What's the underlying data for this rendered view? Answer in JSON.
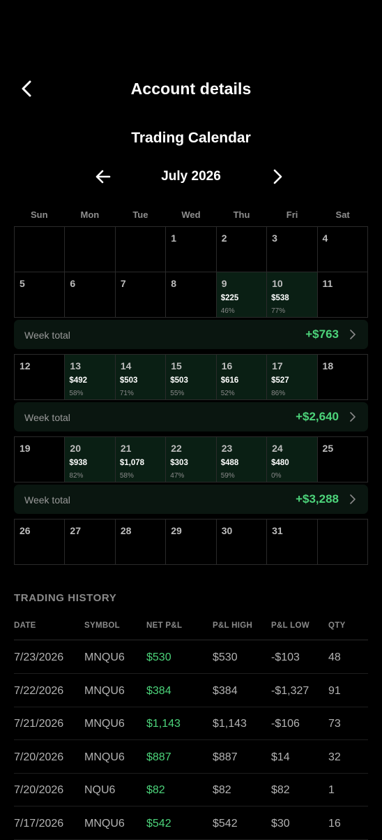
{
  "header": {
    "title": "Account details",
    "back_icon": "chevron-left-icon"
  },
  "calendar": {
    "title": "Trading Calendar",
    "month_label": "July 2026",
    "weekdays": [
      "Sun",
      "Mon",
      "Tue",
      "Wed",
      "Thu",
      "Fri",
      "Sat"
    ],
    "accent_color": "#4cd37a",
    "week_total_label": "Week total",
    "weeks": [
      {
        "days": [
          {
            "num": ""
          },
          {
            "num": ""
          },
          {
            "num": ""
          },
          {
            "num": "1"
          },
          {
            "num": "2"
          },
          {
            "num": "3"
          },
          {
            "num": "4"
          }
        ],
        "total": null
      },
      {
        "days": [
          {
            "num": "5"
          },
          {
            "num": "6"
          },
          {
            "num": "7"
          },
          {
            "num": "8"
          },
          {
            "num": "9",
            "amount": "$225",
            "pct": "46%"
          },
          {
            "num": "10",
            "amount": "$538",
            "pct": "77%"
          },
          {
            "num": "11"
          }
        ],
        "total": "+$763"
      },
      {
        "days": [
          {
            "num": "12"
          },
          {
            "num": "13",
            "amount": "$492",
            "pct": "58%"
          },
          {
            "num": "14",
            "amount": "$503",
            "pct": "71%"
          },
          {
            "num": "15",
            "amount": "$503",
            "pct": "55%"
          },
          {
            "num": "16",
            "amount": "$616",
            "pct": "52%"
          },
          {
            "num": "17",
            "amount": "$527",
            "pct": "86%"
          },
          {
            "num": "18"
          }
        ],
        "total": "+$2,640"
      },
      {
        "days": [
          {
            "num": "19"
          },
          {
            "num": "20",
            "amount": "$938",
            "pct": "82%"
          },
          {
            "num": "21",
            "amount": "$1,078",
            "pct": "58%"
          },
          {
            "num": "22",
            "amount": "$303",
            "pct": "47%"
          },
          {
            "num": "23",
            "amount": "$488",
            "pct": "59%"
          },
          {
            "num": "24",
            "amount": "$480",
            "pct": "0%"
          },
          {
            "num": "25"
          }
        ],
        "total": "+$3,288"
      },
      {
        "days": [
          {
            "num": "26"
          },
          {
            "num": "27"
          },
          {
            "num": "28"
          },
          {
            "num": "29"
          },
          {
            "num": "30"
          },
          {
            "num": "31"
          },
          {
            "num": ""
          }
        ],
        "total": null
      }
    ]
  },
  "history": {
    "title": "TRADING HISTORY",
    "columns": [
      "DATE",
      "SYMBOL",
      "NET P&L",
      "P&L HIGH",
      "P&L LOW",
      "QTY"
    ],
    "rows": [
      [
        "7/23/2026",
        "MNQU6",
        "$530",
        "$530",
        "-$103",
        "48"
      ],
      [
        "7/22/2026",
        "MNQU6",
        "$384",
        "$384",
        "-$1,327",
        "91"
      ],
      [
        "7/21/2026",
        "MNQU6",
        "$1,143",
        "$1,143",
        "-$106",
        "73"
      ],
      [
        "7/20/2026",
        "MNQU6",
        "$887",
        "$887",
        "$14",
        "32"
      ],
      [
        "7/20/2026",
        "NQU6",
        "$82",
        "$82",
        "$82",
        "1"
      ],
      [
        "7/17/2026",
        "MNQU6",
        "$542",
        "$542",
        "$30",
        "16"
      ]
    ]
  }
}
